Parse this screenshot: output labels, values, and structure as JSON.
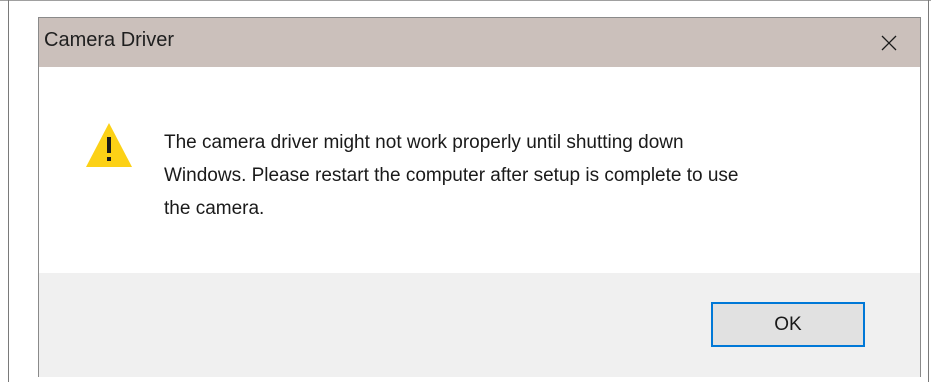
{
  "dialog": {
    "title": "Camera Driver",
    "close_icon": "close-icon",
    "warning_icon": "warning-icon",
    "message_lines": [
      "The camera driver might not work properly until shutting down",
      "Windows. Please restart the computer after setup is complete to use",
      "the camera."
    ],
    "ok_label": "OK"
  },
  "colors": {
    "title_bar": "#cbc0bb",
    "footer": "#f0f0f0",
    "button_border_focus": "#0078d7",
    "warning_yellow": "#fcd116"
  }
}
